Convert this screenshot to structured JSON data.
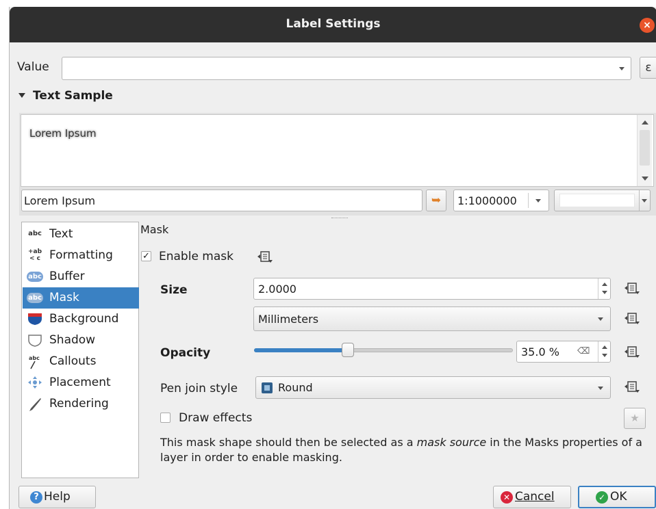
{
  "window": {
    "title": "Label Settings",
    "close_glyph": "×"
  },
  "value_row": {
    "label": "Value",
    "value": "",
    "expr_glyph": "ε"
  },
  "text_sample": {
    "header": "Text Sample",
    "preview_text": "Lorem Ipsum",
    "input_value": "Lorem Ipsum",
    "scale": "1:1000000",
    "background_color": "#ffffff"
  },
  "tabs": [
    {
      "label": "Text",
      "icon": "text-abc-icon",
      "selected": false
    },
    {
      "label": "Formatting",
      "icon": "formatting-icon",
      "selected": false
    },
    {
      "label": "Buffer",
      "icon": "buffer-icon",
      "selected": false
    },
    {
      "label": "Mask",
      "icon": "mask-icon",
      "selected": true
    },
    {
      "label": "Background",
      "icon": "background-icon",
      "selected": false
    },
    {
      "label": "Shadow",
      "icon": "shadow-icon",
      "selected": false
    },
    {
      "label": "Callouts",
      "icon": "callouts-icon",
      "selected": false
    },
    {
      "label": "Placement",
      "icon": "placement-icon",
      "selected": false
    },
    {
      "label": "Rendering",
      "icon": "rendering-icon",
      "selected": false
    }
  ],
  "mask": {
    "heading": "Mask",
    "enable_label": "Enable mask",
    "enable_checked": true,
    "size_label": "Size",
    "size_value": "2.0000",
    "unit_value": "Millimeters",
    "opacity_label": "Opacity",
    "opacity_value": "35.0 %",
    "opacity_fraction": 0.35,
    "pen_join_label": "Pen join style",
    "pen_join_value": "Round",
    "draw_effects_label": "Draw effects",
    "draw_effects_checked": false,
    "help_text_before": "This mask shape should then be selected as a ",
    "help_text_emph": "mask source",
    "help_text_after": " in the Masks properties of a layer in order to enable masking."
  },
  "buttons": {
    "help": "Help",
    "cancel": "Cancel",
    "ok": "OK"
  },
  "colors": {
    "selection": "#3a81c3",
    "titlebar": "#2f2f2f",
    "close": "#e9542b"
  }
}
